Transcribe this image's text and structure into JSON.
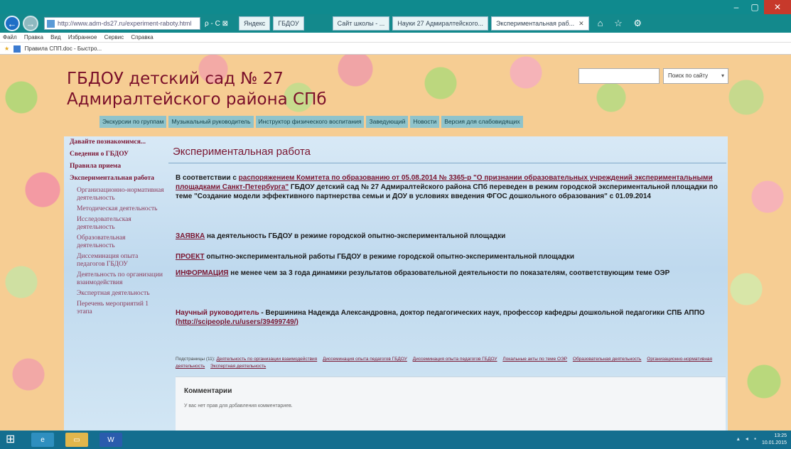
{
  "window": {
    "controls": {
      "minimize": "‒",
      "maximize": "▢",
      "close": "✕"
    }
  },
  "browser": {
    "back_glyph": "←",
    "forward_glyph": "→",
    "address": "http://www.adm-ds27.ru/experiment-raboty.html",
    "address_tools": "ρ - C ⊠",
    "tabs": [
      {
        "label": "Яндекс",
        "active": false
      },
      {
        "label": "ГБДОУ",
        "active": false
      },
      {
        "label": "Сайт школы - ...",
        "active": false
      },
      {
        "label": "Науки 27 Адмиралтейского...",
        "active": false
      },
      {
        "label": "Экспериментальная раб...",
        "active": true
      }
    ],
    "tab_close": "✕",
    "nav_icons": "⌂ ☆ ⚙"
  },
  "menubar": [
    "Файл",
    "Правка",
    "Вид",
    "Избранное",
    "Сервис",
    "Справка"
  ],
  "favorites": {
    "item": "Правила СПП.doc - Быстро..."
  },
  "site": {
    "title": "ГБДОУ детский сад № 27 Адмиралтейского района СПб",
    "search_scope": "Поиск по сайту",
    "search_arrow": "▾"
  },
  "topnav": [
    "Экскурсии по группам",
    "Музыкальный руководитель",
    "Инструктор физического воспитания",
    "Заведующий",
    "Новости",
    "Версия для слабовидящих"
  ],
  "sidebar": {
    "items": [
      {
        "label": "Давайте познакомимся...",
        "sub": false
      },
      {
        "label": "Сведения о ГБДОУ",
        "sub": false
      },
      {
        "label": "Правила приема",
        "sub": false
      },
      {
        "label": "Экспериментальная работа",
        "sub": false
      },
      {
        "label": "Организационно-нормативная деятельность",
        "sub": true
      },
      {
        "label": "Методическая деятельность",
        "sub": true
      },
      {
        "label": "Исследовательская деятельность",
        "sub": true
      },
      {
        "label": "Образовательная деятельность",
        "sub": true
      },
      {
        "label": "Диссеминация опыта педагогов ГБДОУ",
        "sub": true
      },
      {
        "label": "Деятельность по организации взаимодействия",
        "sub": true
      },
      {
        "label": "Экспертная деятельность",
        "sub": true
      },
      {
        "label": "Перечень мероприятий 1 этапа",
        "sub": true
      }
    ]
  },
  "content": {
    "heading": "Экспериментальная работа",
    "p1_prefix": "В соответствии с ",
    "p1_link": "распоряжением Комитета по образованию от 05.08.2014 № 3365-р \"О признании образовательных учреждений экспериментальными площадками Санкт-Петербурга\"",
    "p1_rest": " ГБДОУ детский сад № 27 Адмиралтейского района СПб переведен в режим городской экспериментальной площадки по теме \"Создание модели эффективного партнерства семьи и ДОУ в условиях введения ФГОС дошкольного образования\" с 01.09.2014",
    "p2_link": "ЗАЯВКА",
    "p2_rest": " на деятельность ГБДОУ в режиме городской опытно-экспериментальной площадки",
    "p3_link": "ПРОЕКТ",
    "p3_rest": " опытно-экспериментальной работы ГБДОУ в режиме городской опытно-экспериментальной площадки",
    "p4_link": "ИНФОРМАЦИЯ",
    "p4_rest": " не менее чем за 3 года динамики результатов образовательной деятельности по показателям,           соответствующим теме ОЭР",
    "p5_prefix": "Научный руководитель",
    "p5_rest": " - Вершинина Надежда Александровна, доктор педагогических наук, профессор кафедры дошкольной педагогики СПБ АППО ",
    "p5_link": "(http://scipeople.ru/users/39499749/)",
    "subpages_label": "Подстраницы (11): ",
    "subpages": [
      "Деятельность по организации взаимодействия",
      "Диссеминация опыта педагогов ГБДОУ",
      "Диссеминация опыта педагогов ГБДОУ",
      "Локальные акты по теме ОЭР",
      "Образовательная деятельность",
      "Организационно-нормативная деятельность",
      "Экспертная деятельность"
    ],
    "comments_title": "Комментарии",
    "comments_note": "У вас нет прав для добавления комментариев."
  },
  "taskbar": {
    "start_glyph": "⊞",
    "word_label": "W",
    "tray": "▴ ◂ ▪",
    "time": "13:25",
    "date": "10.01.2015"
  }
}
